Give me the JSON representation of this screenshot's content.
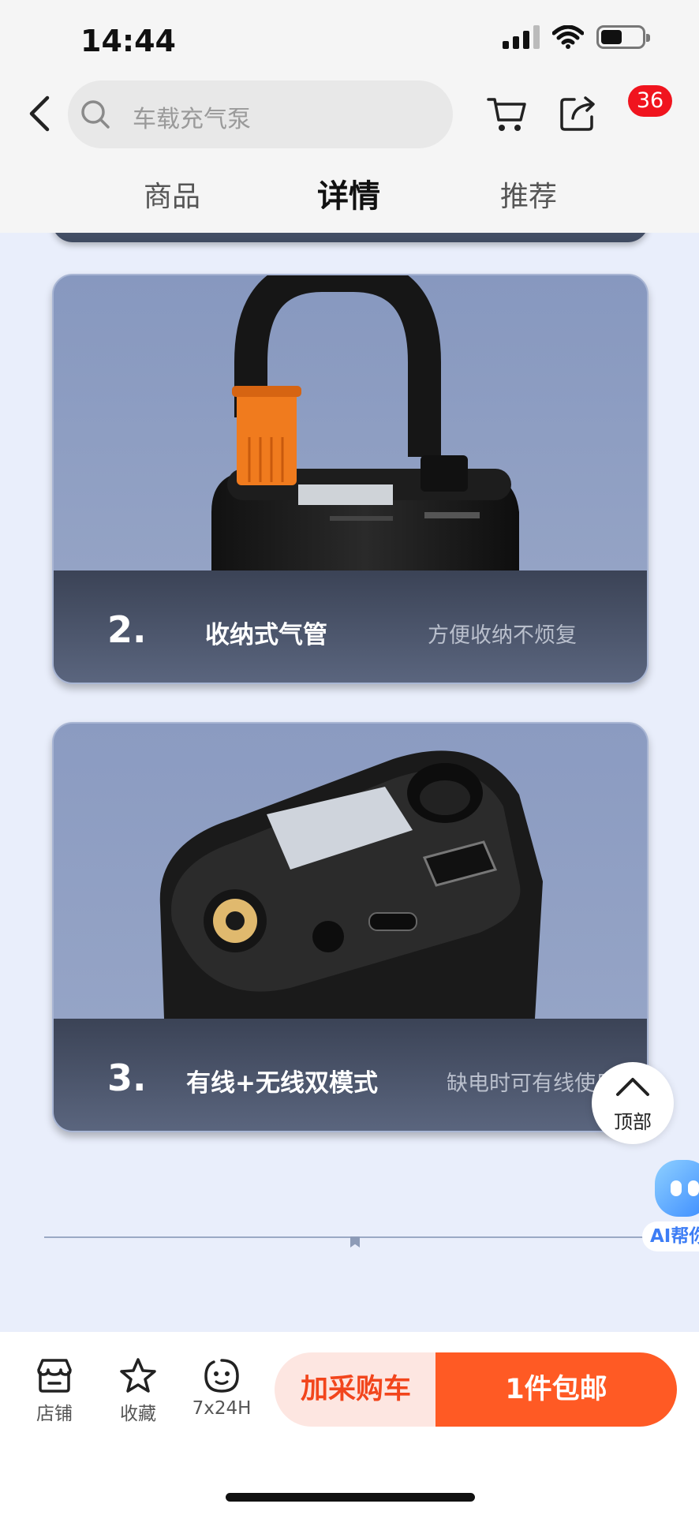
{
  "status_bar": {
    "time": "14:44"
  },
  "header": {
    "search_placeholder": "车载充气泵",
    "message_badge": "36"
  },
  "tabs": [
    {
      "label": "商品",
      "active": false
    },
    {
      "label": "详情",
      "active": true
    },
    {
      "label": "推荐",
      "active": false
    }
  ],
  "features": [
    {
      "number": "2.",
      "title": "收纳式气管",
      "subtitle": "方便收纳不烦复"
    },
    {
      "number": "3.",
      "title": "有线+无线双模式",
      "subtitle": "缺电时可有线使用"
    }
  ],
  "floating": {
    "back_to_top_label": "顶部",
    "ai_helper_label": "AI帮你"
  },
  "bottom_bar": {
    "shop_label": "店铺",
    "favorite_label": "收藏",
    "service_label": "7x24H",
    "add_cart_label": "加采购车",
    "buy_label": "1件包邮"
  },
  "colors": {
    "accent": "#ff5a24",
    "add_cart_bg": "#fde6e1",
    "badge": "#f0141e",
    "card_bg": "#8f9fc2"
  }
}
